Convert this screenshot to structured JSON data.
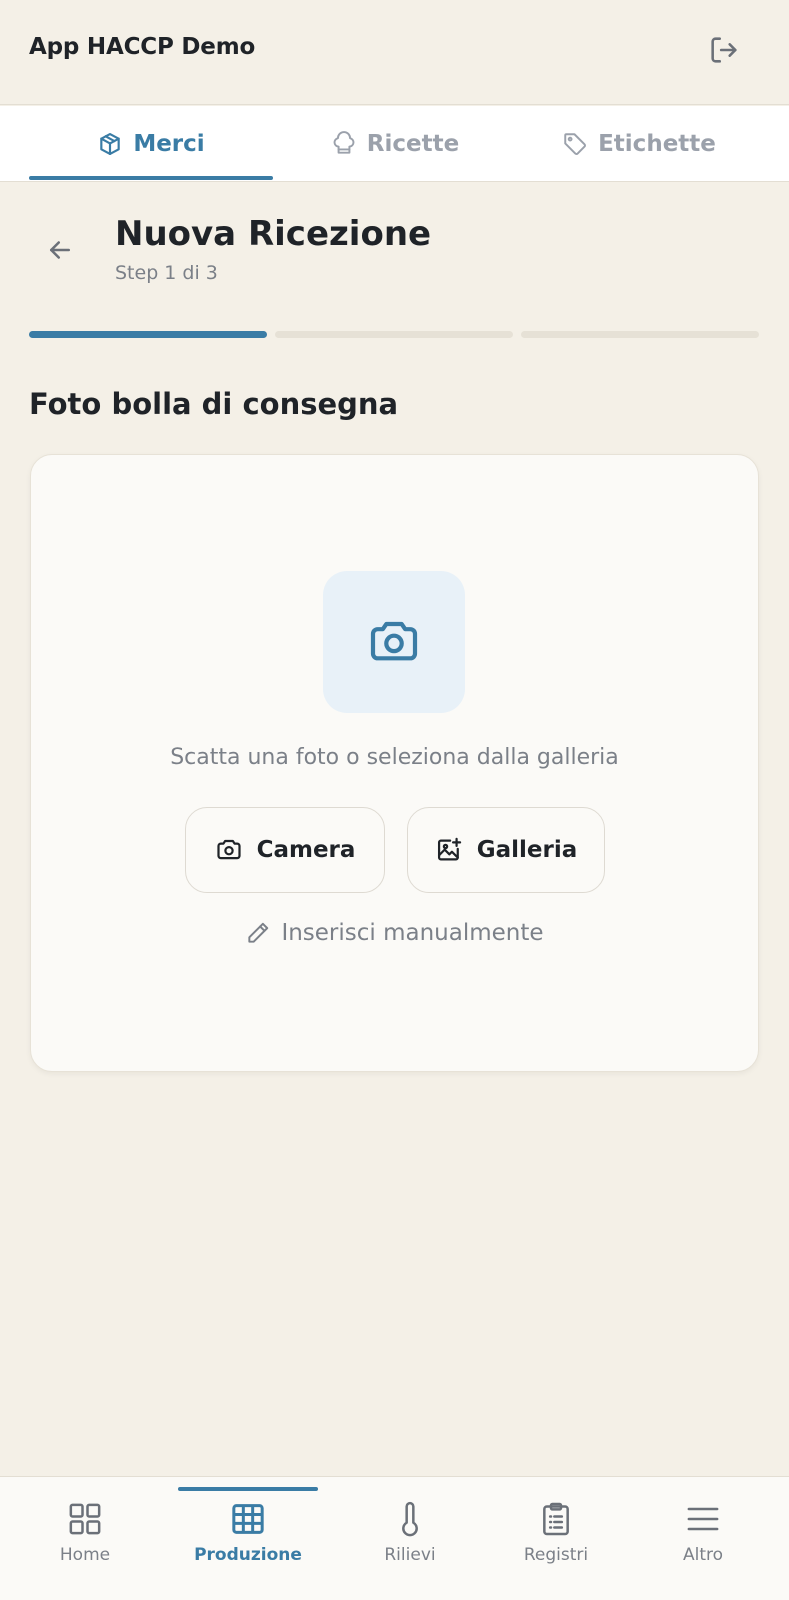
{
  "app": {
    "title": "App HACCP Demo",
    "logout_icon": "logout-icon"
  },
  "tabs": [
    {
      "label": "Merci",
      "icon": "box-icon",
      "active": true
    },
    {
      "label": "Ricette",
      "icon": "chef-hat-icon",
      "active": false
    },
    {
      "label": "Etichette",
      "icon": "tag-icon",
      "active": false
    }
  ],
  "page": {
    "title": "Nuova Ricezione",
    "subtitle": "Step 1 di 3",
    "steps_total": 3,
    "step_current": 1
  },
  "section": {
    "title": "Foto bolla di consegna"
  },
  "upload": {
    "hint": "Scatta una foto o seleziona dalla galleria",
    "camera_label": "Camera",
    "gallery_label": "Galleria",
    "manual_label": "Inserisci manualmente"
  },
  "bottom_nav": [
    {
      "label": "Home",
      "icon": "grid-icon",
      "active": false
    },
    {
      "label": "Produzione",
      "icon": "table-icon",
      "active": true
    },
    {
      "label": "Rilievi",
      "icon": "thermometer-icon",
      "active": false
    },
    {
      "label": "Registri",
      "icon": "clipboard-icon",
      "active": false
    },
    {
      "label": "Altro",
      "icon": "menu-icon",
      "active": false
    }
  ],
  "colors": {
    "accent": "#3a7ca5",
    "background": "#f4f0e7",
    "muted_text": "#7b8088",
    "inactive_tab": "#9ba1ab"
  }
}
